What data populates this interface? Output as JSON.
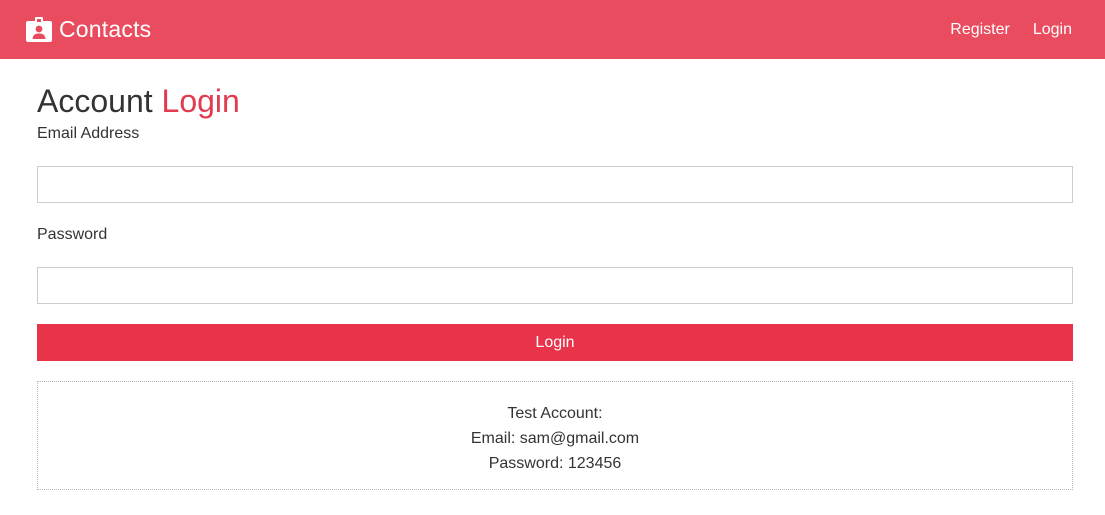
{
  "navbar": {
    "brand": "Contacts",
    "brand_icon": "id-badge-icon",
    "links": [
      "Register",
      "Login"
    ],
    "background": "#ea4c5f"
  },
  "page": {
    "title_main": "Account",
    "title_accent": "Login",
    "accent_color": "#e23a4f"
  },
  "form": {
    "email_label": "Email Address",
    "email_value": "",
    "password_label": "Password",
    "password_value": "",
    "submit_label": "Login",
    "submit_color": "#e8334b"
  },
  "test_account": {
    "heading": "Test Account:",
    "email_line": "Email: sam@gmail.com",
    "password_line": "Password: 123456"
  }
}
